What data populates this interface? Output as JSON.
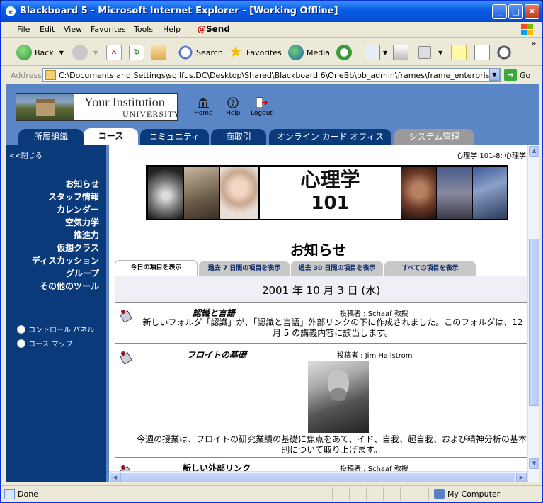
{
  "window": {
    "title": "Blackboard 5 - Microsoft Internet Explorer - [Working Offline]"
  },
  "menu": [
    "File",
    "Edit",
    "View",
    "Favorites",
    "Tools",
    "Help"
  ],
  "send_label": "Send",
  "toolbar": {
    "back": "Back",
    "search": "Search",
    "favorites": "Favorites",
    "media": "Media"
  },
  "address": {
    "label": "Address",
    "url": "C:\\Documents and Settings\\sgilfus.DC\\Desktop\\Shared\\Blackboard 6\\OneBb\\bb_admin\\frames\\frame_enterprise_course_ja.ht",
    "go": "Go"
  },
  "header": {
    "institution_name": "Your Institution",
    "institution_sub": "UNIVERSITY",
    "home": "Home",
    "help": "Help",
    "logout": "Logout"
  },
  "tabs": [
    "所属組織",
    "コース",
    "コミュニティ",
    "商取引",
    "オンライン カード オフィス",
    "システム管理"
  ],
  "leftnav": {
    "collapse": "<<閉じる",
    "items": [
      "お知らせ",
      "スタッフ情報",
      "カレンダー",
      "空気力学",
      "推進力",
      "仮想クラス",
      "ディスカッション",
      "グループ",
      "その他のツール"
    ],
    "tools": [
      "コントロール パネル",
      "コース マップ"
    ]
  },
  "main": {
    "breadcrumb": "心理学 101-8: 心理学",
    "banner_line1": "心理学",
    "banner_line2": "101",
    "page_title": "お知らせ",
    "subtabs": [
      "今日の項目を表示",
      "過去 7 日間の項目を表示",
      "過去 30 日間の項目を表示",
      "すべての項目を表示"
    ],
    "date": "2001 年 10 月 3 日 (水)",
    "announcements": [
      {
        "title": "認識と言語",
        "poster": "投稿者 : Schaaf 教授",
        "body": "新しいフォルダ「認識」が、「認識と言語」外部リンクの下に作成されました。このフォルダは、12 月 5 の講義内容に該当します。"
      },
      {
        "title": "フロイトの基礎",
        "poster": "投稿者 : Jim Hallstrom",
        "body": "今週の授業は、フロイトの研究業績の基礎に焦点をあて、イド、自我、超自我、および精神分析の基本則について取り上げます。"
      },
      {
        "title": "新しい外部リンク",
        "poster": "投稿者 : Schaaf 教授"
      }
    ]
  },
  "status": {
    "left": "Done",
    "zone": "My Computer"
  },
  "colors": {
    "nav_dark": "#0a3a7a",
    "header_blue": "#5a86c6",
    "xp_titlebar": "#0550d8"
  }
}
